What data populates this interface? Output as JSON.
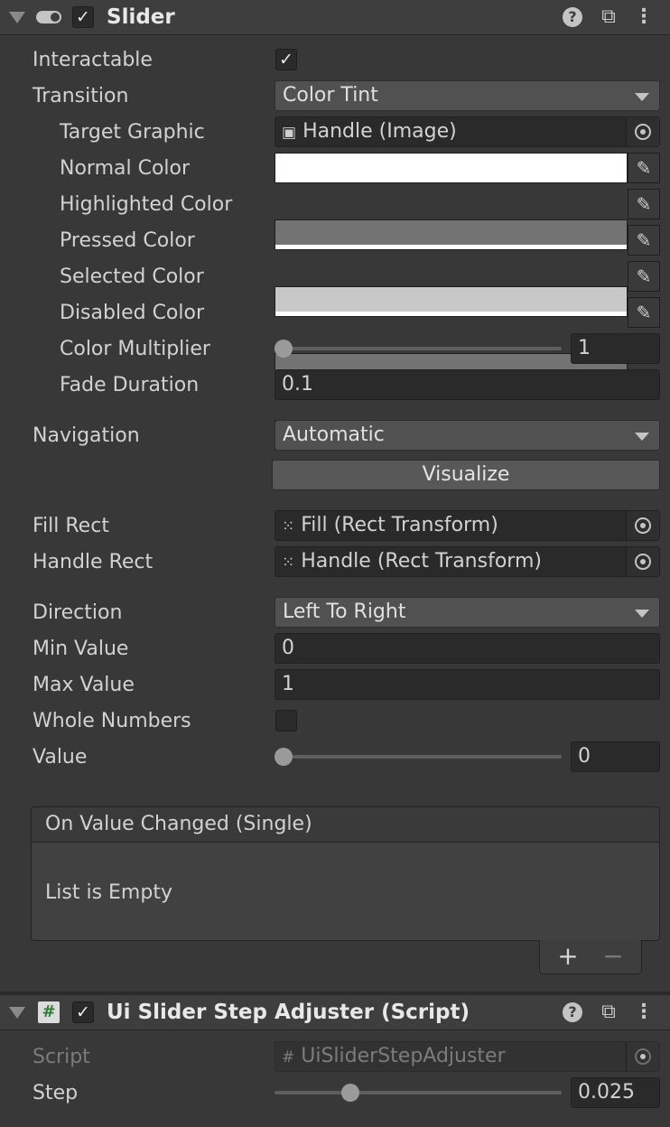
{
  "slider_component": {
    "title": "Slider",
    "enabled": true,
    "interactable_label": "Interactable",
    "interactable_checked": true,
    "transition": {
      "label": "Transition",
      "value": "Color Tint"
    },
    "target_graphic": {
      "label": "Target Graphic",
      "value": "Handle (Image)"
    },
    "colors": [
      {
        "label": "Normal Color",
        "color": "#ffffff",
        "alpha": 1.0
      },
      {
        "label": "Highlighted Color",
        "color": "#737373",
        "alpha": 1.0
      },
      {
        "label": "Pressed Color",
        "color": "#c8c8c8",
        "alpha": 1.0
      },
      {
        "label": "Selected Color",
        "color": "#737373",
        "alpha": 1.0
      },
      {
        "label": "Disabled Color",
        "color": "#c8c8c8",
        "alpha": 0.5
      }
    ],
    "color_multiplier": {
      "label": "Color Multiplier",
      "value": "1",
      "min": 1,
      "max": 5,
      "current": 1
    },
    "fade_duration": {
      "label": "Fade Duration",
      "value": "0.1"
    },
    "navigation": {
      "label": "Navigation",
      "value": "Automatic"
    },
    "visualize_label": "Visualize",
    "fill_rect": {
      "label": "Fill Rect",
      "value": "Fill (Rect Transform)"
    },
    "handle_rect": {
      "label": "Handle Rect",
      "value": "Handle (Rect Transform)"
    },
    "direction": {
      "label": "Direction",
      "value": "Left To Right"
    },
    "min_value": {
      "label": "Min Value",
      "value": "0"
    },
    "max_value": {
      "label": "Max Value",
      "value": "1"
    },
    "whole_numbers": {
      "label": "Whole Numbers",
      "checked": false
    },
    "value": {
      "label": "Value",
      "value": "0",
      "fraction": 0
    },
    "on_value_changed": {
      "header": "On Value Changed (Single)",
      "empty_text": "List is Empty",
      "plus": "+",
      "minus": "−"
    }
  },
  "step_adjuster_component": {
    "title": "Ui Slider Step Adjuster (Script)",
    "enabled": true,
    "script": {
      "label": "Script",
      "value": "UiSliderStepAdjuster"
    },
    "step": {
      "label": "Step",
      "value": "0.025",
      "fraction": 0.25
    }
  },
  "icons": {
    "help": "?",
    "presets": "⧉",
    "menu": "⋮",
    "check": "✓",
    "eyedropper": "✎",
    "script_hash": "#"
  }
}
